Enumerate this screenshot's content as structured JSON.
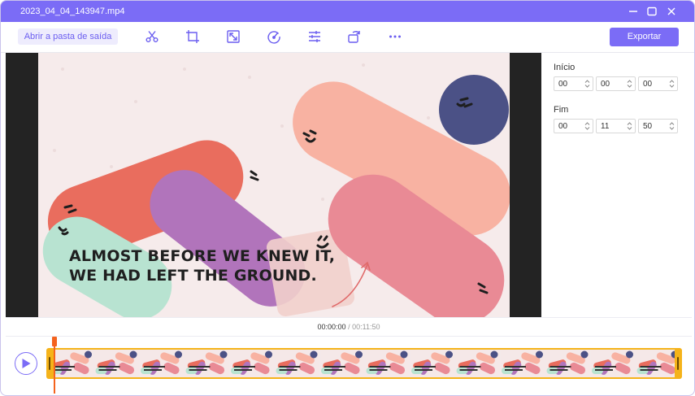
{
  "window": {
    "title": "2023_04_04_143947.mp4",
    "accent": "#7b6cf6"
  },
  "window_controls": [
    "minimize-icon",
    "maximize-icon",
    "close-icon"
  ],
  "toolbar": {
    "open_folder_label": "Abrir a pasta de saída",
    "tools": [
      "scissors-icon",
      "crop-icon",
      "resize-icon",
      "speed-icon",
      "adjust-icon",
      "rotate-icon",
      "more-icon"
    ],
    "export_label": "Exportar"
  },
  "preview": {
    "caption_line1": "ALMOST BEFORE WE KNEW IT,",
    "caption_line2": "WE HAD LEFT THE GROUND."
  },
  "trim": {
    "start_label": "Início",
    "start": [
      "00",
      "00",
      "00"
    ],
    "end_label": "Fim",
    "end": [
      "00",
      "11",
      "50"
    ]
  },
  "playback": {
    "current_time": "00:00:00",
    "separator": " / ",
    "total_time": "00:11:50"
  },
  "timeline": {
    "frame_count": 14,
    "handle_color": "#f5b31a",
    "playhead_color": "#f4631e"
  }
}
